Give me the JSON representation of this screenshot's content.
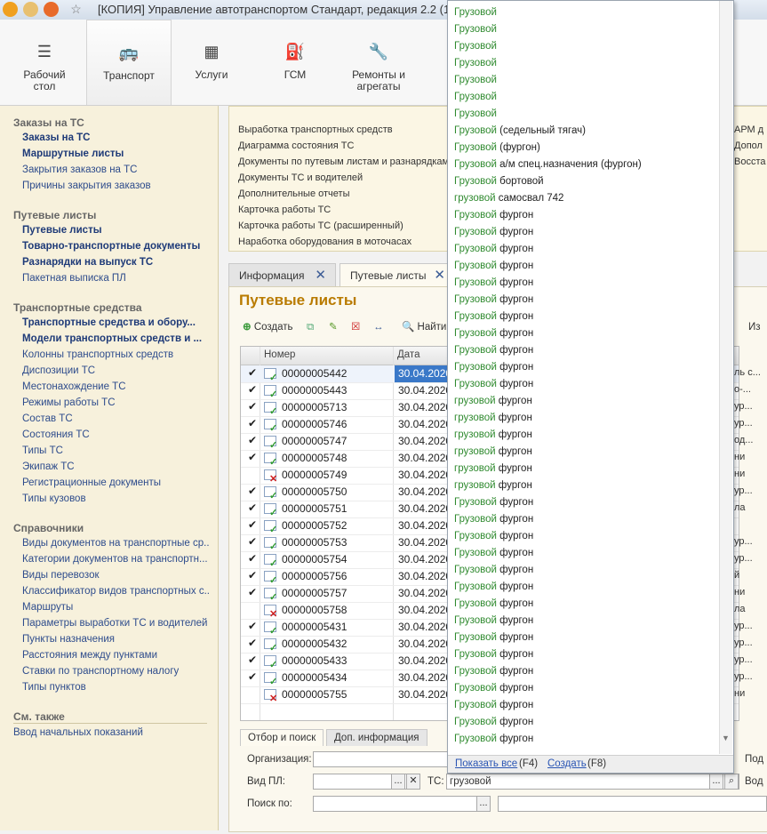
{
  "window": {
    "title": "[КОПИЯ] Управление автотранспортом Стандарт, редакция 2.2  (1С:Предприятие)"
  },
  "ribbon": [
    {
      "label": "Рабочий\nстол",
      "icon": "list-icon"
    },
    {
      "label": "Транспорт",
      "icon": "bus-icon"
    },
    {
      "label": "Услуги",
      "icon": "calculator-icon"
    },
    {
      "label": "ГСМ",
      "icon": "fuel-icon"
    },
    {
      "label": "Ремонты и\nагрегаты",
      "icon": "wrench-icon"
    }
  ],
  "leftnav": {
    "sections": [
      {
        "title": "Заказы на ТС",
        "items": [
          {
            "label": "Заказы на ТС",
            "bold": true
          },
          {
            "label": "Маршрутные листы",
            "bold": true
          },
          {
            "label": "Закрытия заказов на ТС",
            "bold": false
          },
          {
            "label": "Причины закрытия заказов",
            "bold": false
          }
        ]
      },
      {
        "title": "Путевые листы",
        "items": [
          {
            "label": "Путевые листы",
            "bold": true
          },
          {
            "label": "Товарно-транспортные документы",
            "bold": true
          },
          {
            "label": "Разнарядки на выпуск ТС",
            "bold": true
          },
          {
            "label": "Пакетная выписка ПЛ",
            "bold": false
          }
        ]
      },
      {
        "title": "Транспортные средства",
        "items": [
          {
            "label": "Транспортные средства и обору...",
            "bold": true
          },
          {
            "label": "Модели транспортных средств и ...",
            "bold": true
          },
          {
            "label": "Колонны транспортных средств",
            "bold": false
          },
          {
            "label": "Диспозиции ТС",
            "bold": false
          },
          {
            "label": "Местонахождение ТС",
            "bold": false
          },
          {
            "label": "Режимы работы ТС",
            "bold": false
          },
          {
            "label": "Состав ТС",
            "bold": false
          },
          {
            "label": "Состояния ТС",
            "bold": false
          },
          {
            "label": "Типы ТС",
            "bold": false
          },
          {
            "label": "Экипаж ТС",
            "bold": false
          },
          {
            "label": "Регистрационные документы",
            "bold": false
          },
          {
            "label": "Типы кузовов",
            "bold": false
          }
        ]
      },
      {
        "title": "Справочники",
        "items": [
          {
            "label": "Виды документов на транспортные ср...",
            "bold": false
          },
          {
            "label": "Категории документов на транспортн...",
            "bold": false
          },
          {
            "label": "Виды перевозок",
            "bold": false
          },
          {
            "label": "Классификатор видов транспортных с...",
            "bold": false
          },
          {
            "label": "Маршруты",
            "bold": false
          },
          {
            "label": "Параметры выработки ТС и водителей",
            "bold": false
          },
          {
            "label": "Пункты назначения",
            "bold": false
          },
          {
            "label": "Расстояния между пунктами",
            "bold": false
          },
          {
            "label": "Ставки по транспортному налогу",
            "bold": false
          },
          {
            "label": "Типы пунктов",
            "bold": false
          }
        ]
      },
      {
        "title": "См. также",
        "items": [
          {
            "label": "Ввод начальных показаний",
            "bold": false
          }
        ]
      }
    ]
  },
  "reports": [
    "Выработка транспортных средств",
    "Диаграмма состояния ТС",
    "Документы по путевым листам и разнарядкам",
    "Документы ТС и водителей",
    "Дополнительные отчеты",
    "Карточка работы ТС",
    "Карточка работы ТС (расширенный)",
    "Наработка оборудования в моточасах"
  ],
  "reports_right": [
    "АРМ д",
    "Допол",
    "Восста"
  ],
  "tabs": [
    {
      "label": "Информация"
    },
    {
      "label": "Путевые листы"
    }
  ],
  "doc": {
    "title": "Путевые листы",
    "toolbar": {
      "create": "Создать",
      "find": "Найти...",
      "right": "Из"
    },
    "columns": {
      "number": "Номер",
      "date": "Дата"
    },
    "rows": [
      {
        "num": "00000005442",
        "date": "30.04.2020",
        "posted": true,
        "extra": "ль с..."
      },
      {
        "num": "00000005443",
        "date": "30.04.2020",
        "posted": true,
        "extra": "о-..."
      },
      {
        "num": "00000005713",
        "date": "30.04.2020",
        "posted": true,
        "extra": "ур..."
      },
      {
        "num": "00000005746",
        "date": "30.04.2020",
        "posted": true,
        "extra": "ур..."
      },
      {
        "num": "00000005747",
        "date": "30.04.2020",
        "posted": true,
        "extra": "од..."
      },
      {
        "num": "00000005748",
        "date": "30.04.2020",
        "posted": true,
        "extra": "ни"
      },
      {
        "num": "00000005749",
        "date": "30.04.2020",
        "posted": false,
        "extra": "ни"
      },
      {
        "num": "00000005750",
        "date": "30.04.2020",
        "posted": true,
        "extra": "ур..."
      },
      {
        "num": "00000005751",
        "date": "30.04.2020",
        "posted": true,
        "extra": "ла"
      },
      {
        "num": "00000005752",
        "date": "30.04.2020",
        "posted": true,
        "extra": ""
      },
      {
        "num": "00000005753",
        "date": "30.04.2020",
        "posted": true,
        "extra": "ур..."
      },
      {
        "num": "00000005754",
        "date": "30.04.2020",
        "posted": true,
        "extra": "ур..."
      },
      {
        "num": "00000005756",
        "date": "30.04.2020",
        "posted": true,
        "extra": "й"
      },
      {
        "num": "00000005757",
        "date": "30.04.2020",
        "posted": true,
        "extra": "ни"
      },
      {
        "num": "00000005758",
        "date": "30.04.2020",
        "posted": false,
        "extra": "ла"
      },
      {
        "num": "00000005431",
        "date": "30.04.2020",
        "posted": true,
        "extra": "ур..."
      },
      {
        "num": "00000005432",
        "date": "30.04.2020",
        "posted": true,
        "extra": "ур..."
      },
      {
        "num": "00000005433",
        "date": "30.04.2020",
        "posted": true,
        "extra": "ур..."
      },
      {
        "num": "00000005434",
        "date": "30.04.2020",
        "posted": true,
        "extra": "ур..."
      },
      {
        "num": "00000005755",
        "date": "30.04.2020",
        "posted": false,
        "extra": "ни"
      }
    ]
  },
  "bottom": {
    "tabs": [
      "Отбор и поиск",
      "Доп. информация"
    ],
    "org_label": "Организация:",
    "vidpl_label": "Вид ПЛ:",
    "ts_label": "ТС:",
    "ts_value": "грузовой",
    "search_label": "Поиск по:",
    "right1": "Под",
    "right2": "Вод"
  },
  "dropdown": {
    "items": [
      {
        "g": "Грузовой",
        "t": ""
      },
      {
        "g": "Грузовой",
        "t": ""
      },
      {
        "g": "Грузовой",
        "t": ""
      },
      {
        "g": "Грузовой",
        "t": ""
      },
      {
        "g": "Грузовой",
        "t": ""
      },
      {
        "g": "Грузовой",
        "t": ""
      },
      {
        "g": "Грузовой",
        "t": ""
      },
      {
        "g": "Грузовой",
        "t": " (седельный тягач)"
      },
      {
        "g": "Грузовой",
        "t": " (фургон)"
      },
      {
        "g": "Грузовой",
        "t": " а/м спец.назначения (фургон)"
      },
      {
        "g": "Грузовой",
        "t": " бортовой"
      },
      {
        "g": "грузовой",
        "t": " самосвал 742"
      },
      {
        "g": "Грузовой",
        "t": " фургон"
      },
      {
        "g": "Грузовой",
        "t": " фургон"
      },
      {
        "g": "Грузовой",
        "t": " фургон"
      },
      {
        "g": "Грузовой",
        "t": " фургон"
      },
      {
        "g": "Грузовой",
        "t": " фургон"
      },
      {
        "g": "Грузовой",
        "t": " фургон"
      },
      {
        "g": "Грузовой",
        "t": " фургон"
      },
      {
        "g": "Грузовой",
        "t": " фургон"
      },
      {
        "g": "Грузовой",
        "t": " фургон"
      },
      {
        "g": "Грузовой",
        "t": " фургон"
      },
      {
        "g": "Грузовой",
        "t": " фургон"
      },
      {
        "g": "грузовой",
        "t": " фургон"
      },
      {
        "g": "грузовой",
        "t": " фургон"
      },
      {
        "g": "грузовой",
        "t": " фургон"
      },
      {
        "g": "грузовой",
        "t": " фургон"
      },
      {
        "g": "грузовой",
        "t": " фургон"
      },
      {
        "g": "грузовой",
        "t": " фургон"
      },
      {
        "g": "Грузовой",
        "t": " фургон"
      },
      {
        "g": "Грузовой",
        "t": " фургон"
      },
      {
        "g": "Грузовой",
        "t": " фургон"
      },
      {
        "g": "Грузовой",
        "t": " фургон"
      },
      {
        "g": "Грузовой",
        "t": " фургон"
      },
      {
        "g": "Грузовой",
        "t": " фургон"
      },
      {
        "g": "Грузовой",
        "t": " фургон"
      },
      {
        "g": "Грузовой",
        "t": " фургон"
      },
      {
        "g": "Грузовой",
        "t": " фургон"
      },
      {
        "g": "Грузовой",
        "t": " фургон"
      },
      {
        "g": "Грузовой",
        "t": " фургон"
      },
      {
        "g": "Грузовой",
        "t": " фургон"
      },
      {
        "g": "Грузовой",
        "t": " фургон"
      },
      {
        "g": "Грузовой",
        "t": " фургон"
      },
      {
        "g": "Грузовой",
        "t": " фургон"
      }
    ],
    "show_all": "Показать все",
    "show_all_key": "(F4)",
    "create": "Создать",
    "create_key": "(F8)"
  }
}
